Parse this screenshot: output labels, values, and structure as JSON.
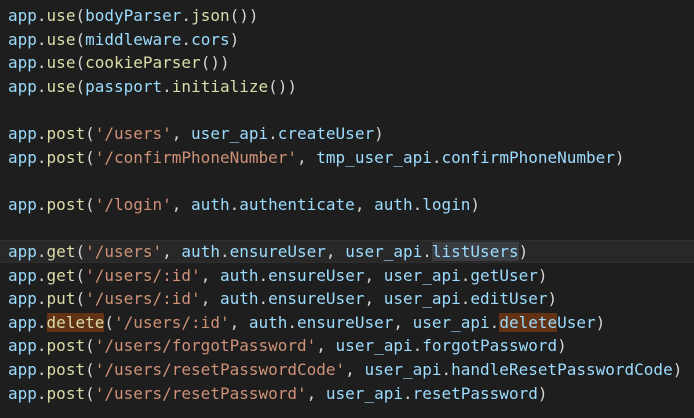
{
  "colors": {
    "background": "#1e1e1e",
    "current_line": "#282828",
    "variable": "#9cdcfe",
    "function": "#dcdcaa",
    "string": "#ce9178",
    "punctuation": "#d4d4d4",
    "word_highlight": "#613214",
    "selection_highlight": "#3a3d41"
  },
  "lines": [
    {
      "tokens": [
        {
          "t": "app",
          "k": "var"
        },
        {
          "t": ".",
          "k": "pun"
        },
        {
          "t": "use",
          "k": "fn"
        },
        {
          "t": "(",
          "k": "pun"
        },
        {
          "t": "bodyParser",
          "k": "var"
        },
        {
          "t": ".",
          "k": "pun"
        },
        {
          "t": "json",
          "k": "fn"
        },
        {
          "t": "())",
          "k": "pun"
        }
      ]
    },
    {
      "tokens": [
        {
          "t": "app",
          "k": "var"
        },
        {
          "t": ".",
          "k": "pun"
        },
        {
          "t": "use",
          "k": "fn"
        },
        {
          "t": "(",
          "k": "pun"
        },
        {
          "t": "middleware",
          "k": "var"
        },
        {
          "t": ".",
          "k": "pun"
        },
        {
          "t": "cors",
          "k": "var"
        },
        {
          "t": ")",
          "k": "pun"
        }
      ]
    },
    {
      "tokens": [
        {
          "t": "app",
          "k": "var"
        },
        {
          "t": ".",
          "k": "pun"
        },
        {
          "t": "use",
          "k": "fn"
        },
        {
          "t": "(",
          "k": "pun"
        },
        {
          "t": "cookieParser",
          "k": "fn"
        },
        {
          "t": "())",
          "k": "pun"
        }
      ]
    },
    {
      "tokens": [
        {
          "t": "app",
          "k": "var"
        },
        {
          "t": ".",
          "k": "pun"
        },
        {
          "t": "use",
          "k": "fn"
        },
        {
          "t": "(",
          "k": "pun"
        },
        {
          "t": "passport",
          "k": "var"
        },
        {
          "t": ".",
          "k": "pun"
        },
        {
          "t": "initialize",
          "k": "fn"
        },
        {
          "t": "())",
          "k": "pun"
        }
      ]
    },
    {
      "tokens": []
    },
    {
      "tokens": [
        {
          "t": "app",
          "k": "var"
        },
        {
          "t": ".",
          "k": "pun"
        },
        {
          "t": "post",
          "k": "fn"
        },
        {
          "t": "(",
          "k": "pun"
        },
        {
          "t": "'/users'",
          "k": "str"
        },
        {
          "t": ", ",
          "k": "pun"
        },
        {
          "t": "user_api",
          "k": "var"
        },
        {
          "t": ".",
          "k": "pun"
        },
        {
          "t": "createUser",
          "k": "var"
        },
        {
          "t": ")",
          "k": "pun"
        }
      ]
    },
    {
      "tokens": [
        {
          "t": "app",
          "k": "var"
        },
        {
          "t": ".",
          "k": "pun"
        },
        {
          "t": "post",
          "k": "fn"
        },
        {
          "t": "(",
          "k": "pun"
        },
        {
          "t": "'/confirmPhoneNumber'",
          "k": "str"
        },
        {
          "t": ", ",
          "k": "pun"
        },
        {
          "t": "tmp_user_api",
          "k": "var"
        },
        {
          "t": ".",
          "k": "pun"
        },
        {
          "t": "confirmPhoneNumber",
          "k": "var"
        },
        {
          "t": ")",
          "k": "pun"
        }
      ]
    },
    {
      "tokens": []
    },
    {
      "tokens": [
        {
          "t": "app",
          "k": "var"
        },
        {
          "t": ".",
          "k": "pun"
        },
        {
          "t": "post",
          "k": "fn"
        },
        {
          "t": "(",
          "k": "pun"
        },
        {
          "t": "'/login'",
          "k": "str"
        },
        {
          "t": ", ",
          "k": "pun"
        },
        {
          "t": "auth",
          "k": "var"
        },
        {
          "t": ".",
          "k": "pun"
        },
        {
          "t": "authenticate",
          "k": "var"
        },
        {
          "t": ", ",
          "k": "pun"
        },
        {
          "t": "auth",
          "k": "var"
        },
        {
          "t": ".",
          "k": "pun"
        },
        {
          "t": "login",
          "k": "var"
        },
        {
          "t": ")",
          "k": "pun"
        }
      ]
    },
    {
      "tokens": []
    },
    {
      "current": true,
      "tokens": [
        {
          "t": "app",
          "k": "var"
        },
        {
          "t": ".",
          "k": "pun"
        },
        {
          "t": "get",
          "k": "fn"
        },
        {
          "t": "(",
          "k": "pun"
        },
        {
          "t": "'/users'",
          "k": "str"
        },
        {
          "t": ", ",
          "k": "pun"
        },
        {
          "t": "auth",
          "k": "var"
        },
        {
          "t": ".",
          "k": "pun"
        },
        {
          "t": "ensureUser",
          "k": "var"
        },
        {
          "t": ", ",
          "k": "pun"
        },
        {
          "t": "user_api",
          "k": "var"
        },
        {
          "t": ".",
          "k": "pun"
        },
        {
          "t": "listUsers",
          "k": "var",
          "sel": true
        },
        {
          "t": ")",
          "k": "pun"
        }
      ]
    },
    {
      "tokens": [
        {
          "t": "app",
          "k": "var"
        },
        {
          "t": ".",
          "k": "pun"
        },
        {
          "t": "get",
          "k": "fn"
        },
        {
          "t": "(",
          "k": "pun"
        },
        {
          "t": "'/users/:id'",
          "k": "str"
        },
        {
          "t": ", ",
          "k": "pun"
        },
        {
          "t": "auth",
          "k": "var"
        },
        {
          "t": ".",
          "k": "pun"
        },
        {
          "t": "ensureUser",
          "k": "var"
        },
        {
          "t": ", ",
          "k": "pun"
        },
        {
          "t": "user_api",
          "k": "var"
        },
        {
          "t": ".",
          "k": "pun"
        },
        {
          "t": "getUser",
          "k": "var"
        },
        {
          "t": ")",
          "k": "pun"
        }
      ]
    },
    {
      "tokens": [
        {
          "t": "app",
          "k": "var"
        },
        {
          "t": ".",
          "k": "pun"
        },
        {
          "t": "put",
          "k": "fn"
        },
        {
          "t": "(",
          "k": "pun"
        },
        {
          "t": "'/users/:id'",
          "k": "str"
        },
        {
          "t": ", ",
          "k": "pun"
        },
        {
          "t": "auth",
          "k": "var"
        },
        {
          "t": ".",
          "k": "pun"
        },
        {
          "t": "ensureUser",
          "k": "var"
        },
        {
          "t": ", ",
          "k": "pun"
        },
        {
          "t": "user_api",
          "k": "var"
        },
        {
          "t": ".",
          "k": "pun"
        },
        {
          "t": "editUser",
          "k": "var"
        },
        {
          "t": ")",
          "k": "pun"
        }
      ]
    },
    {
      "tokens": [
        {
          "t": "app",
          "k": "var"
        },
        {
          "t": ".",
          "k": "pun"
        },
        {
          "t": "delete",
          "k": "fn",
          "hl": true
        },
        {
          "t": "(",
          "k": "pun"
        },
        {
          "t": "'/users/:id'",
          "k": "str"
        },
        {
          "t": ", ",
          "k": "pun"
        },
        {
          "t": "auth",
          "k": "var"
        },
        {
          "t": ".",
          "k": "pun"
        },
        {
          "t": "ensureUser",
          "k": "var"
        },
        {
          "t": ", ",
          "k": "pun"
        },
        {
          "t": "user_api",
          "k": "var"
        },
        {
          "t": ".",
          "k": "pun"
        },
        {
          "t": "delete",
          "k": "var",
          "hl": true
        },
        {
          "t": "User",
          "k": "var"
        },
        {
          "t": ")",
          "k": "pun"
        }
      ]
    },
    {
      "tokens": [
        {
          "t": "app",
          "k": "var"
        },
        {
          "t": ".",
          "k": "pun"
        },
        {
          "t": "post",
          "k": "fn"
        },
        {
          "t": "(",
          "k": "pun"
        },
        {
          "t": "'/users/forgotPassword'",
          "k": "str"
        },
        {
          "t": ", ",
          "k": "pun"
        },
        {
          "t": "user_api",
          "k": "var"
        },
        {
          "t": ".",
          "k": "pun"
        },
        {
          "t": "forgotPassword",
          "k": "var"
        },
        {
          "t": ")",
          "k": "pun"
        }
      ]
    },
    {
      "tokens": [
        {
          "t": "app",
          "k": "var"
        },
        {
          "t": ".",
          "k": "pun"
        },
        {
          "t": "post",
          "k": "fn"
        },
        {
          "t": "(",
          "k": "pun"
        },
        {
          "t": "'/users/resetPasswordCode'",
          "k": "str"
        },
        {
          "t": ", ",
          "k": "pun"
        },
        {
          "t": "user_api",
          "k": "var"
        },
        {
          "t": ".",
          "k": "pun"
        },
        {
          "t": "handleResetPasswordCode",
          "k": "var"
        },
        {
          "t": ")",
          "k": "pun"
        }
      ]
    },
    {
      "tokens": [
        {
          "t": "app",
          "k": "var"
        },
        {
          "t": ".",
          "k": "pun"
        },
        {
          "t": "post",
          "k": "fn"
        },
        {
          "t": "(",
          "k": "pun"
        },
        {
          "t": "'/users/resetPassword'",
          "k": "str"
        },
        {
          "t": ", ",
          "k": "pun"
        },
        {
          "t": "user_api",
          "k": "var"
        },
        {
          "t": ".",
          "k": "pun"
        },
        {
          "t": "resetPassword",
          "k": "var"
        },
        {
          "t": ")",
          "k": "pun"
        }
      ]
    }
  ]
}
